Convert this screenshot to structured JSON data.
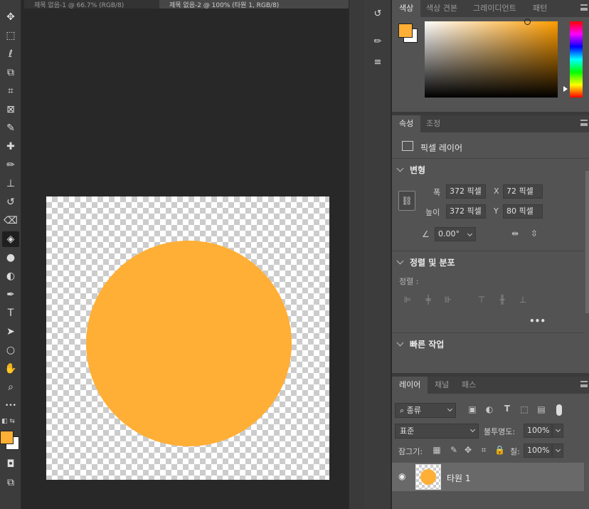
{
  "document_tabs": [
    {
      "label": "제목 없음-1 @ 66.7% (RGB/8)",
      "active": false
    },
    {
      "label": "제목 없음-2 @ 100% (타원 1, RGB/8)",
      "active": true
    }
  ],
  "toolbar": {
    "tools": [
      {
        "name": "move-tool",
        "glyph": "✥"
      },
      {
        "name": "marquee-tool",
        "glyph": "⬚"
      },
      {
        "name": "lasso-tool",
        "glyph": "ℓ"
      },
      {
        "name": "object-select-tool",
        "glyph": "⧉"
      },
      {
        "name": "crop-tool",
        "glyph": "⌗"
      },
      {
        "name": "frame-tool",
        "glyph": "⊠"
      },
      {
        "name": "eyedropper-tool",
        "glyph": "✎"
      },
      {
        "name": "healing-brush-tool",
        "glyph": "✚"
      },
      {
        "name": "brush-tool",
        "glyph": "✏"
      },
      {
        "name": "clone-stamp-tool",
        "glyph": "⊥"
      },
      {
        "name": "history-brush-tool",
        "glyph": "↺"
      },
      {
        "name": "eraser-tool",
        "glyph": "⌫"
      },
      {
        "name": "paint-bucket-tool",
        "glyph": "◈"
      },
      {
        "name": "blur-tool",
        "glyph": "●"
      },
      {
        "name": "dodge-tool",
        "glyph": "◐"
      },
      {
        "name": "pen-tool",
        "glyph": "✒"
      },
      {
        "name": "type-tool",
        "glyph": "T"
      },
      {
        "name": "path-select-tool",
        "glyph": "➤"
      },
      {
        "name": "ellipse-tool",
        "glyph": "○"
      },
      {
        "name": "hand-tool",
        "glyph": "✋"
      },
      {
        "name": "zoom-tool",
        "glyph": "⌕"
      },
      {
        "name": "more-tools",
        "glyph": "•••"
      }
    ],
    "foreground_color": "#ffaf36",
    "background_color": "#ffffff"
  },
  "canvas": {
    "layer_fill": "#ffaf36"
  },
  "color_panel": {
    "tabs": [
      "색상",
      "색상 견본",
      "그레이디언트",
      "패턴"
    ],
    "active_tab": "색상",
    "swatch_fg": "#ffaf36",
    "swatch_bg": "#ffffff",
    "picker_hue": "#ff9d00"
  },
  "properties_panel": {
    "tabs": [
      "속성",
      "조정"
    ],
    "layer_type_label": "픽셀 레이어",
    "transform": {
      "title": "변형",
      "width_label": "폭",
      "width_value": "372 픽셀",
      "height_label": "높이",
      "height_value": "372 픽셀",
      "x_label": "X",
      "x_value": "72 픽셀",
      "y_label": "Y",
      "y_value": "80 픽셀",
      "angle_value": "0.00°"
    },
    "align": {
      "title": "정렬 및 분포",
      "align_label": "정렬 :"
    },
    "quick_actions_title": "빠른 작업"
  },
  "layers_panel": {
    "tabs": [
      "레이어",
      "채널",
      "패스"
    ],
    "filter_kind": "종류",
    "blend_mode": "표준",
    "opacity_label": "불투명도:",
    "opacity_value": "100%",
    "lock_label": "잠그기:",
    "fill_label": "칠:",
    "fill_value": "100%",
    "layers": [
      {
        "name": "타원 1",
        "visible": true,
        "thumb_color": "#ffaf36"
      }
    ]
  }
}
